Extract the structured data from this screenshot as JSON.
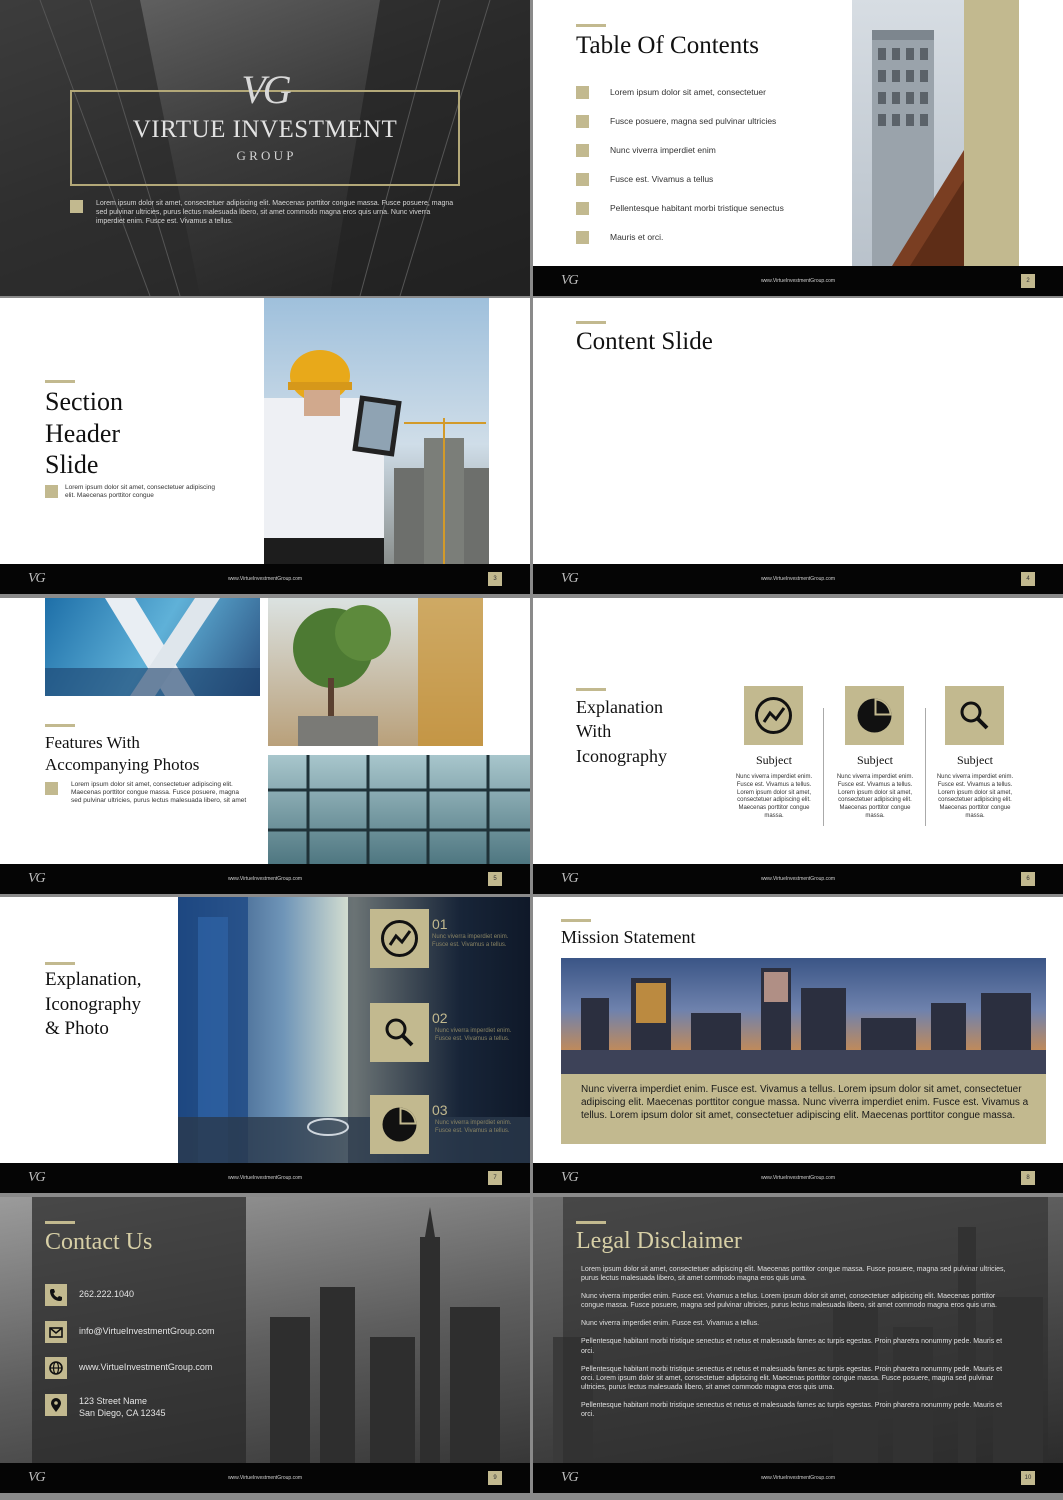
{
  "brand": {
    "monogram": "VG",
    "name": "VIRTUE INVESTMENT",
    "group": "G R O U P",
    "url": "www.VirtueInvestmentGroup.com",
    "accent": "#c2b98f",
    "footer_color": "#050505"
  },
  "slide1": {
    "text": "Lorem ipsum dolor sit amet, consectetuer adipiscing elit. Maecenas porttitor congue massa. Fusce posuere, magna sed pulvinar ultricies, purus lectus malesuada libero, sit amet commodo magna eros quis urna.  Nunc viverra imperdiet enim. Fusce est. Vivamus a tellus."
  },
  "slide2": {
    "title": "Table Of Contents",
    "items": [
      "Lorem ipsum dolor sit amet, consectetuer",
      "Fusce posuere, magna sed pulvinar ultricies",
      "Nunc viverra imperdiet enim",
      "Fusce est. Vivamus a tellus",
      "Pellentesque habitant morbi tristique senectus",
      "Mauris et orci."
    ],
    "page": "2"
  },
  "slide3": {
    "title_line1": "Section",
    "title_line2": "Header",
    "title_line3": "Slide",
    "text": "Lorem ipsum dolor sit amet, consectetuer adipiscing elit. Maecenas porttitor congue",
    "page": "3"
  },
  "slide4": {
    "title": "Content Slide",
    "page": "4"
  },
  "slide5": {
    "title_line1": "Features With",
    "title_line2": "Accompanying Photos",
    "text": "Lorem ipsum dolor sit amet, consectetuer adipiscing elit. Maecenas porttitor congue massa. Fusce posuere, magna sed pulvinar ultricies, purus lectus malesuada libero, sit amet",
    "page": "5"
  },
  "slide6": {
    "title_line1": "Explanation",
    "title_line2": "With",
    "title_line3": "Iconography",
    "subjects": [
      {
        "label": "Subject",
        "icon": "trend-chart-icon",
        "text": "Nunc viverra imperdiet enim. Fusce est. Vivamus a tellus. Lorem ipsum dolor sit amet, consectetuer adipiscing elit. Maecenas porttitor congue massa."
      },
      {
        "label": "Subject",
        "icon": "pie-chart-icon",
        "text": "Nunc viverra imperdiet enim. Fusce est. Vivamus a tellus. Lorem ipsum dolor sit amet, consectetuer adipiscing elit. Maecenas porttitor congue massa."
      },
      {
        "label": "Subject",
        "icon": "magnifier-icon",
        "text": "Nunc viverra imperdiet enim. Fusce est. Vivamus a tellus. Lorem ipsum dolor sit amet, consectetuer adipiscing elit. Maecenas porttitor congue massa."
      }
    ],
    "page": "6"
  },
  "slide7": {
    "title_line1": "Explanation,",
    "title_line2": "Iconography",
    "title_line3": "& Photo",
    "items": [
      {
        "num": "01",
        "icon": "trend-chart-icon",
        "text": "Nunc viverra imperdiet enim. Fusce est. Vivamus a tellus."
      },
      {
        "num": "02",
        "icon": "magnifier-icon",
        "text": "Nunc viverra imperdiet enim. Fusce est. Vivamus a tellus."
      },
      {
        "num": "03",
        "icon": "pie-chart-icon",
        "text": "Nunc viverra imperdiet enim. Fusce est. Vivamus a tellus."
      }
    ],
    "page": "7"
  },
  "slide8": {
    "title": "Mission Statement",
    "text": "Nunc viverra imperdiet enim. Fusce est. Vivamus a tellus. Lorem ipsum dolor sit amet, consectetuer adipiscing elit. Maecenas porttitor congue massa. Nunc viverra imperdiet enim. Fusce est. Vivamus a tellus. Lorem ipsum dolor sit amet, consectetuer adipiscing elit. Maecenas porttitor congue massa.",
    "page": "8"
  },
  "slide9": {
    "title": "Contact Us",
    "phone": "262.222.1040",
    "email": "info@VirtueInvestmentGroup.com",
    "web": "www.VirtueInvestmentGroup.com",
    "address_line1": "123 Street Name",
    "address_line2": "San Diego, CA 12345",
    "page": "9"
  },
  "slide10": {
    "title": "Legal Disclaimer",
    "paragraphs": [
      "Lorem ipsum dolor sit amet, consectetuer adipiscing elit. Maecenas porttitor congue massa. Fusce posuere, magna sed pulvinar ultricies, purus lectus malesuada libero, sit amet commodo magna eros quis urna.",
      "Nunc viverra imperdiet enim. Fusce est. Vivamus a tellus. Lorem ipsum dolor sit amet, consectetuer adipiscing elit. Maecenas porttitor congue massa. Fusce posuere, magna sed pulvinar ultricies, purus lectus malesuada libero, sit amet commodo magna eros quis urna.",
      "Nunc viverra imperdiet enim. Fusce est. Vivamus a tellus.",
      "Pellentesque habitant morbi tristique senectus et netus et malesuada fames ac turpis egestas. Proin pharetra nonummy pede. Mauris et orci.",
      "Pellentesque habitant morbi tristique senectus et netus et malesuada fames ac turpis egestas. Proin pharetra nonummy pede. Mauris et orci. Lorem ipsum dolor sit amet, consectetuer adipiscing elit. Maecenas porttitor congue massa. Fusce posuere, magna sed pulvinar ultricies, purus lectus malesuada libero, sit amet commodo magna eros quis urna.",
      "Pellentesque habitant morbi tristique senectus et netus et malesuada fames ac turpis egestas. Proin pharetra nonummy pede. Mauris et orci."
    ],
    "page": "10"
  }
}
